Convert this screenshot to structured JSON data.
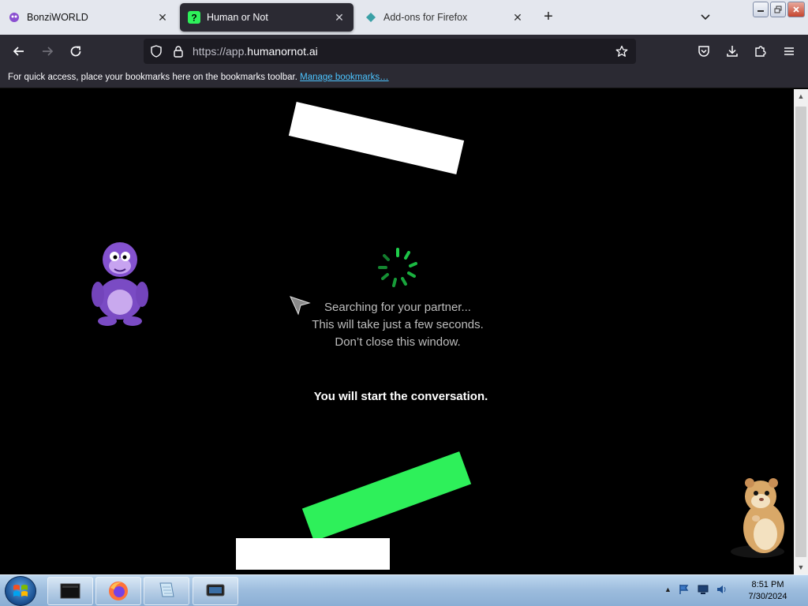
{
  "browser": {
    "tabs": [
      {
        "title": "BonziWORLD",
        "icon": "bonzi-favicon",
        "active": false
      },
      {
        "title": "Human or Not",
        "icon": "question-favicon",
        "active": true
      },
      {
        "title": "Add-ons for Firefox",
        "icon": "addons-favicon",
        "active": false
      }
    ],
    "new_tab_label": "+",
    "url_prefix": "https://app.",
    "url_domain": "humanornot.ai",
    "bookmarks_message": "For quick access, place your bookmarks here on the bookmarks toolbar.",
    "bookmarks_link": "Manage bookmarks…"
  },
  "page": {
    "status_lines": [
      "Searching for your partner...",
      "This will take just a few seconds.",
      "Don’t close this window."
    ],
    "conversation_note": "You will start the conversation."
  },
  "colors": {
    "accent_green": "#2ef05a",
    "spinner_green": "#1fcf4b",
    "tab_active_bg": "#2b2a33",
    "toolbar_bg": "#2b2a33",
    "url_bg": "#1c1b22",
    "link": "#4cc4ff"
  },
  "taskbar": {
    "items": [
      "explorer-window-icon",
      "firefox-icon",
      "notepad-icon",
      "computer-icon"
    ],
    "time": "8:51 PM",
    "date": "7/30/2024"
  }
}
